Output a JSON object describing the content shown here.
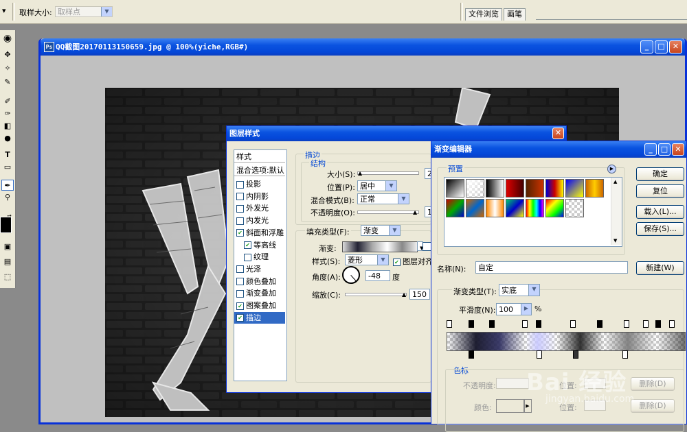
{
  "options_bar": {
    "sample_size_label": "取样大小:",
    "sample_size_value": "取样点",
    "tabs": [
      "文件浏览",
      "画笔"
    ]
  },
  "document": {
    "title": "QQ截图20170113150659.jpg @ 100%(yiche,RGB#)"
  },
  "layer_style": {
    "title": "图层样式",
    "styles_header": "样式",
    "blend_options": "混合选项:默认",
    "effects": [
      {
        "label": "投影",
        "checked": false
      },
      {
        "label": "内阴影",
        "checked": false
      },
      {
        "label": "外发光",
        "checked": false
      },
      {
        "label": "内发光",
        "checked": false
      },
      {
        "label": "斜面和浮雕",
        "checked": true
      },
      {
        "label": "等高线",
        "checked": true
      },
      {
        "label": "纹理",
        "checked": false
      },
      {
        "label": "光泽",
        "checked": false
      },
      {
        "label": "颜色叠加",
        "checked": false
      },
      {
        "label": "渐变叠加",
        "checked": false
      },
      {
        "label": "图案叠加",
        "checked": true
      },
      {
        "label": "描边",
        "checked": true
      }
    ],
    "stroke_group": "描边",
    "structure_group": "结构",
    "size_label": "大小(S):",
    "size_value": "2",
    "position_label": "位置(P):",
    "position_value": "居中",
    "blend_mode_label": "混合模式(B):",
    "blend_mode_value": "正常",
    "opacity_label": "不透明度(O):",
    "opacity_value": "1",
    "fill_type_label": "填充类型(F):",
    "fill_type_value": "渐变",
    "gradient_label": "渐变:",
    "style_label": "样式(S):",
    "style_value": "菱形",
    "align_label": "图层对齐",
    "angle_label": "角度(A):",
    "angle_value": "-48",
    "angle_unit": "度",
    "scale_label": "缩放(C):",
    "scale_value": "150"
  },
  "gradient_editor": {
    "title": "渐变编辑器",
    "presets_label": "预置",
    "ok": "确定",
    "reset": "复位",
    "load": "载入(L)...",
    "save": "保存(S)...",
    "name_label": "名称(N):",
    "name_value": "自定",
    "new_button": "新建(W)",
    "gradient_type_label": "渐变类型(T):",
    "gradient_type_value": "实底",
    "smoothness_label": "平滑度(N):",
    "smoothness_value": "100",
    "smoothness_unit": "%",
    "stops_group": "色标",
    "opacity_label": "不透明度:",
    "color_label": "颜色:",
    "location_label_1": "位置:",
    "location_label_2": "位置:",
    "delete_label_1": "删除(D)",
    "delete_label_2": "删除(D)"
  },
  "watermark": {
    "brand": "Bai  经验",
    "url": "jingyan.baidu.com"
  },
  "colors": {
    "xp_blue": "#0a53e0",
    "dialog_bg": "#ece9d8",
    "canvas_bg": "#262626",
    "selected": "#316ac5"
  }
}
